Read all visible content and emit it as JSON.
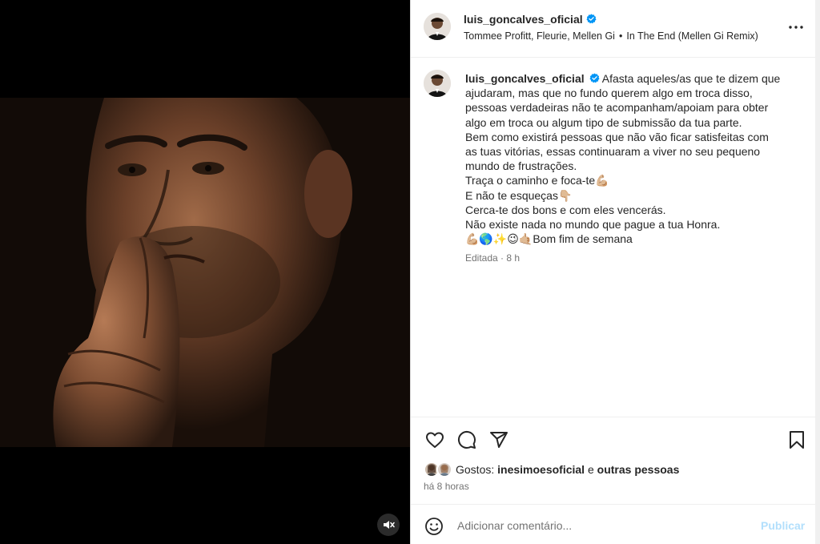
{
  "post": {
    "username": "luis_goncalves_oficial",
    "verified": true,
    "audio": {
      "artists": "Tommee Profitt, Fleurie, Mellen Gi",
      "separator": "•",
      "track": "In The End (Mellen Gi Remix)"
    },
    "more_icon": "more-horizontal-icon"
  },
  "caption": {
    "username": "luis_goncalves_oficial",
    "first_line": "Afasta aqueles/as que te dizem que",
    "lines": [
      "ajudaram, mas que no fundo querem algo em troca disso,",
      "pessoas verdadeiras não te acompanham/apoiam para obter",
      "algo em troca ou algum tipo de submissão da tua parte.",
      "Bem como existirá pessoas que não vão ficar satisfeitas com",
      "as tuas vitórias, essas continuaram a viver no seu pequeno",
      "mundo de frustrações.",
      "Traça o caminho e foca-te💪🏼",
      "E não te esqueças👇🏼",
      "Cerca-te dos bons e com eles vencerás.",
      "Não existe nada no mundo que pague a tua Honra.",
      "💪🏼🌎✨😉🤙🏼Bom fim de semana"
    ],
    "meta": "Editada · 8 h"
  },
  "actions": {
    "like_icon": "heart-icon",
    "comment_icon": "comment-icon",
    "share_icon": "share-icon",
    "save_icon": "bookmark-icon"
  },
  "likes": {
    "prefix": "Gostos:",
    "user": "inesimoesoficial",
    "connector": "e",
    "others": "outras pessoas"
  },
  "time_ago": "há 8 horas",
  "comment": {
    "placeholder": "Adicionar comentário...",
    "publish_label": "Publicar",
    "emoji_icon": "emoji-smile-icon"
  },
  "media": {
    "mute_icon": "muted-speaker-icon"
  },
  "colors": {
    "verified": "#0095f6",
    "publish_disabled": "#b2dffc",
    "muted_text": "#737373"
  }
}
